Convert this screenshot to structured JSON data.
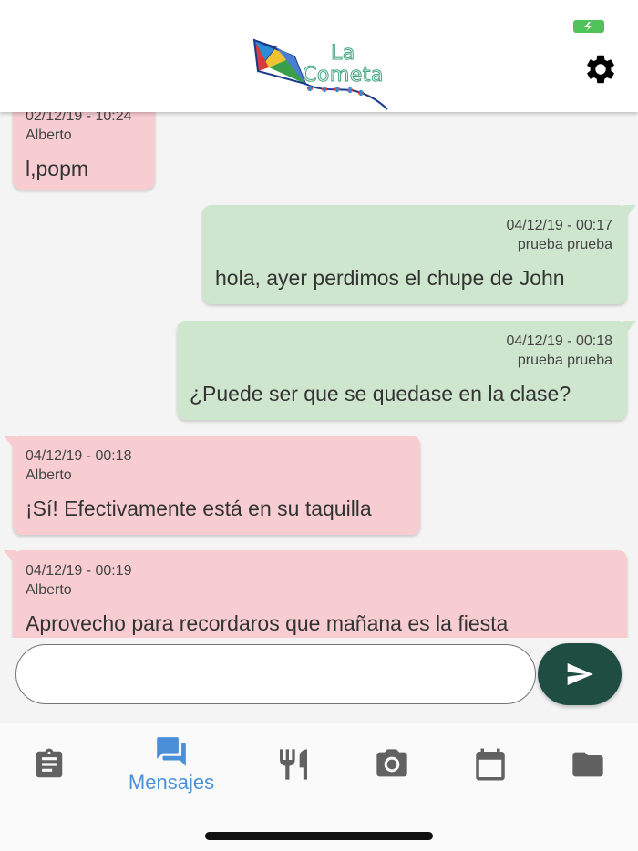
{
  "header": {
    "logo_line1": "La",
    "logo_line2": "Cometa"
  },
  "messages": [
    {
      "direction": "in",
      "datetime": "02/12/19 - 10:24",
      "author": "Alberto",
      "text": "l,popm"
    },
    {
      "direction": "out",
      "datetime": "04/12/19 - 00:17",
      "author": "prueba prueba",
      "text": "hola, ayer perdimos el chupe de John"
    },
    {
      "direction": "out",
      "datetime": "04/12/19 - 00:18",
      "author": "prueba prueba",
      "text": "¿Puede ser que se quedase en la clase?"
    },
    {
      "direction": "in",
      "datetime": "04/12/19 - 00:18",
      "author": "Alberto",
      "text": "¡Sí! Efectivamente está en su taquilla"
    },
    {
      "direction": "in",
      "datetime": "04/12/19 - 00:19",
      "author": "Alberto",
      "text": "Aprovecho para recordaros que mañana es la fiesta"
    }
  ],
  "composer": {
    "value": "",
    "placeholder": ""
  },
  "nav": {
    "items": [
      {
        "icon": "clipboard-icon",
        "label": "",
        "active": false
      },
      {
        "icon": "messages-icon",
        "label": "Mensajes",
        "active": true
      },
      {
        "icon": "restaurant-icon",
        "label": "",
        "active": false
      },
      {
        "icon": "camera-icon",
        "label": "",
        "active": false
      },
      {
        "icon": "calendar-icon",
        "label": "",
        "active": false
      },
      {
        "icon": "folder-icon",
        "label": "",
        "active": false
      }
    ]
  },
  "colors": {
    "incoming_bubble": "#f7cdd1",
    "outgoing_bubble": "#cfe6ce",
    "send_button": "#1f4d42",
    "active_nav": "#4a90d9",
    "inactive_nav": "#616161",
    "battery": "#4fc35a"
  }
}
